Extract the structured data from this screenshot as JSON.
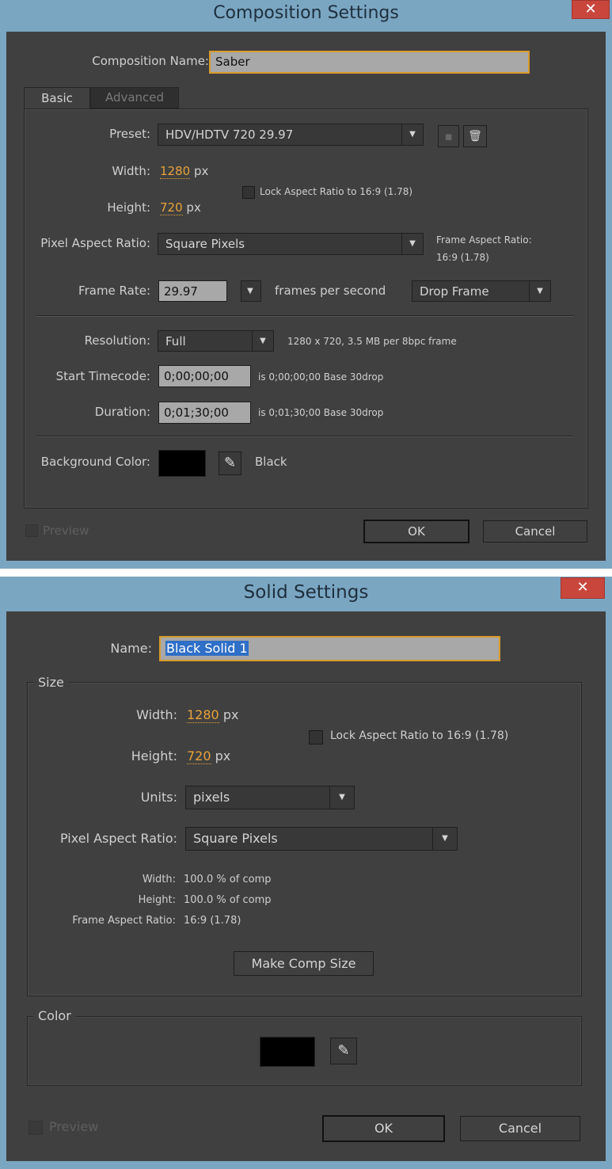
{
  "composition": {
    "title": "Composition Settings",
    "close_glyph": "✕",
    "name_label": "Composition Name:",
    "name_value": "Saber",
    "tabs": [
      {
        "label": "Basic"
      },
      {
        "label": "Advanced"
      }
    ],
    "preset_label": "Preset:",
    "preset_value": "HDV/HDTV 720 29.97",
    "width_label": "Width:",
    "width_value": "1280",
    "height_label": "Height:",
    "height_value": "720",
    "px_unit": "px",
    "lock_label": "Lock Aspect Ratio to 16:9 (1.78)",
    "par_label": "Pixel Aspect Ratio:",
    "par_value": "Square Pixels",
    "frame_aspect_label": "Frame Aspect Ratio:",
    "frame_aspect_value": "16:9 (1.78)",
    "frame_rate_label": "Frame Rate:",
    "frame_rate_value": "29.97",
    "fps_label": "frames per second",
    "drop_frame_value": "Drop Frame",
    "resolution_label": "Resolution:",
    "resolution_value": "Full",
    "resolution_info": "1280 x 720, 3.5 MB per 8bpc frame",
    "start_tc_label": "Start Timecode:",
    "start_tc_value": "0;00;00;00",
    "start_tc_info": "is 0;00;00;00  Base 30drop",
    "duration_label": "Duration:",
    "duration_value": "0;01;30;00",
    "duration_info": "is 0;01;30;00  Base 30drop",
    "bg_label": "Background Color:",
    "bg_name": "Black",
    "bg_color": "#000000",
    "preview_label": "Preview",
    "ok_label": "OK",
    "cancel_label": "Cancel"
  },
  "solid": {
    "title": "Solid Settings",
    "close_glyph": "✕",
    "name_label": "Name:",
    "name_value": "Black Solid 1",
    "size_group": "Size",
    "width_label": "Width:",
    "width_value": "1280",
    "height_label": "Height:",
    "height_value": "720",
    "px_unit": "px",
    "lock_label": "Lock Aspect Ratio to 16:9 (1.78)",
    "units_label": "Units:",
    "units_value": "pixels",
    "par_label": "Pixel Aspect Ratio:",
    "par_value": "Square Pixels",
    "info_width_label": "Width:",
    "info_width_value": "100.0 % of comp",
    "info_height_label": "Height:",
    "info_height_value": "100.0 % of comp",
    "info_far_label": "Frame Aspect Ratio:",
    "info_far_value": "16:9 (1.78)",
    "make_comp_size_label": "Make Comp Size",
    "color_group": "Color",
    "color_value": "#000000",
    "preview_label": "Preview",
    "ok_label": "OK",
    "cancel_label": "Cancel"
  },
  "icons": {
    "dropdown": "▼",
    "eyedropper": "✎",
    "trash": "🗑",
    "save_preset": "▪"
  }
}
